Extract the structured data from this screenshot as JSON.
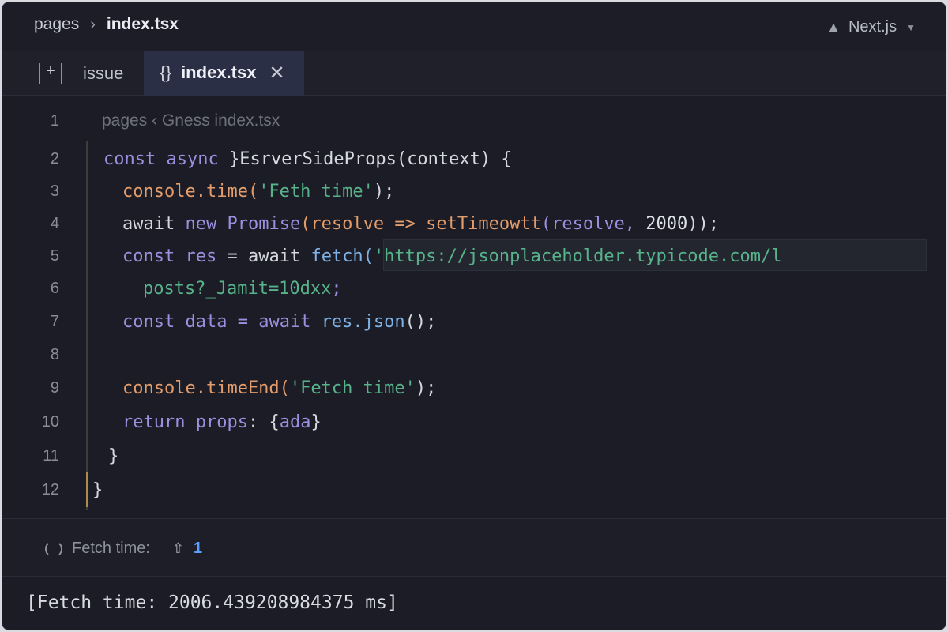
{
  "header": {
    "breadcrumb_folder": "pages",
    "breadcrumb_file": "index.tsx",
    "framework": "Next.js"
  },
  "tabs": [
    {
      "icon": "+",
      "label": "issue"
    },
    {
      "icon": "{}",
      "label": "index.tsx",
      "active": true
    }
  ],
  "editor": {
    "crumb_line": "pages ‹ Gness index.tsx",
    "lines": [
      "1",
      "2",
      "3",
      "4",
      "5",
      "6",
      "7",
      "8",
      "9",
      "10",
      "11",
      "12"
    ],
    "code": {
      "l2_kw": "const async ",
      "l2_rest": "}Esrver",
      "l2_fn": "SideProps",
      "l2_tail": "(context) {",
      "l3_fn": "console.time(",
      "l3_str": "'Feth time'",
      "l3_tail": ");",
      "l4_a": "await ",
      "l4_kw": "new ",
      "l4_cls": "Promise",
      "l4_b": "(resolve => ",
      "l4_fn": "setTimeowtt",
      "l4_c": "(resolve, ",
      "l4_num": "2000",
      "l4_d": "));",
      "l5_kw": "const ",
      "l5_var": "res",
      "l5_b": " = await ",
      "l5_fn": "fetch(",
      "l5_str": "'https://jsonplaceholder.typicode.com/l",
      "l6_str": "posts?_Jamit=10dxx",
      "l6_tail": ";",
      "l7_kw": "const ",
      "l7_var": "data",
      "l7_b": " = await ",
      "l7_fn": "res.json",
      "l7_tail": "();",
      "l9_fn": "console.timeEnd(",
      "l9_str": "'Fetch time'",
      "l9_tail": ");",
      "l10_kw": "return ",
      "l10_prop": "props",
      "l10_b": ": {",
      "l10_var": "ada",
      "l10_tail": "}",
      "l11": "}",
      "l12": "}"
    }
  },
  "panel": {
    "title": "Fetch time:",
    "count": "1",
    "output": "[Fetch time: 2006.439208984375 ms]"
  }
}
